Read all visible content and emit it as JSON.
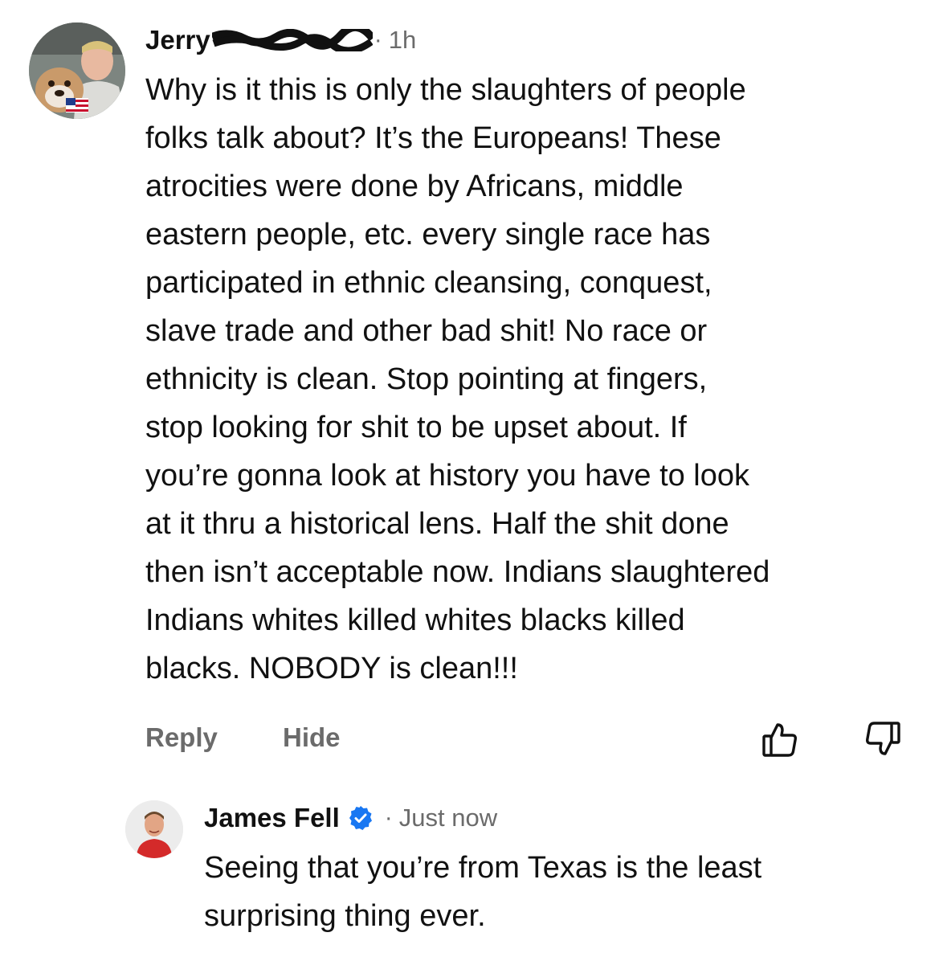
{
  "comments": [
    {
      "author": "Jerry",
      "author_redacted": true,
      "separator": "·",
      "time": "1h",
      "avatar_icon": "profile-photo-man-with-bulldog",
      "text_lines": [
        "Why is it this is only the slaughters of people",
        "folks talk about? It’s the Europeans! These",
        "atrocities were done by Africans, middle",
        "eastern people, etc. every single race has",
        "participated in ethnic cleansing, conquest,",
        "slave trade and other bad shit! No race or",
        "ethnicity is clean. Stop pointing at fingers,",
        "stop looking for shit to be upset about. If",
        "you’re gonna look at history you have to look",
        "at it thru a historical lens. Half the shit done",
        "then isn’t acceptable now. Indians slaughtered",
        "Indians whites killed whites blacks killed",
        "blacks. NOBODY is clean!!!"
      ],
      "actions": {
        "reply": "Reply",
        "hide": "Hide",
        "like_icon": "thumbs-up-icon",
        "dislike_icon": "thumbs-down-icon"
      }
    },
    {
      "author": "James Fell",
      "verified": true,
      "verified_color": "#1877f2",
      "separator": "·",
      "time": "Just now",
      "avatar_icon": "profile-photo-man-red-shirt",
      "text_lines": [
        "Seeing that you’re from Texas is the least",
        "surprising thing ever."
      ]
    }
  ]
}
